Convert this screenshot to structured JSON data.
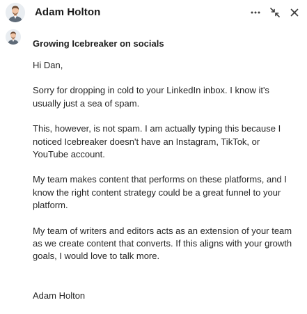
{
  "header": {
    "sender_name": "Adam Holton",
    "icons": [
      "more-icon",
      "minimize-icon",
      "close-icon"
    ]
  },
  "message": {
    "subject": "Growing Icebreaker on socials",
    "greeting": "Hi Dan,",
    "paragraphs": [
      "Sorry for dropping in cold to your LinkedIn inbox. I know it's usually just a sea of spam.",
      "This, however, is not spam. I am actually typing this because I noticed Icebreaker doesn't have an Instagram, TikTok, or YouTube account.",
      "My team makes content that performs on these platforms, and I know the right content strategy could be a great funnel to your platform.",
      "My team of writers and editors acts as an extension of your team as we create content that converts. If this aligns with your growth goals, I would love to talk more."
    ],
    "signature": "Adam Holton"
  },
  "colors": {
    "text": "#262626",
    "icon": "#3d3d3d",
    "background": "#ffffff"
  }
}
